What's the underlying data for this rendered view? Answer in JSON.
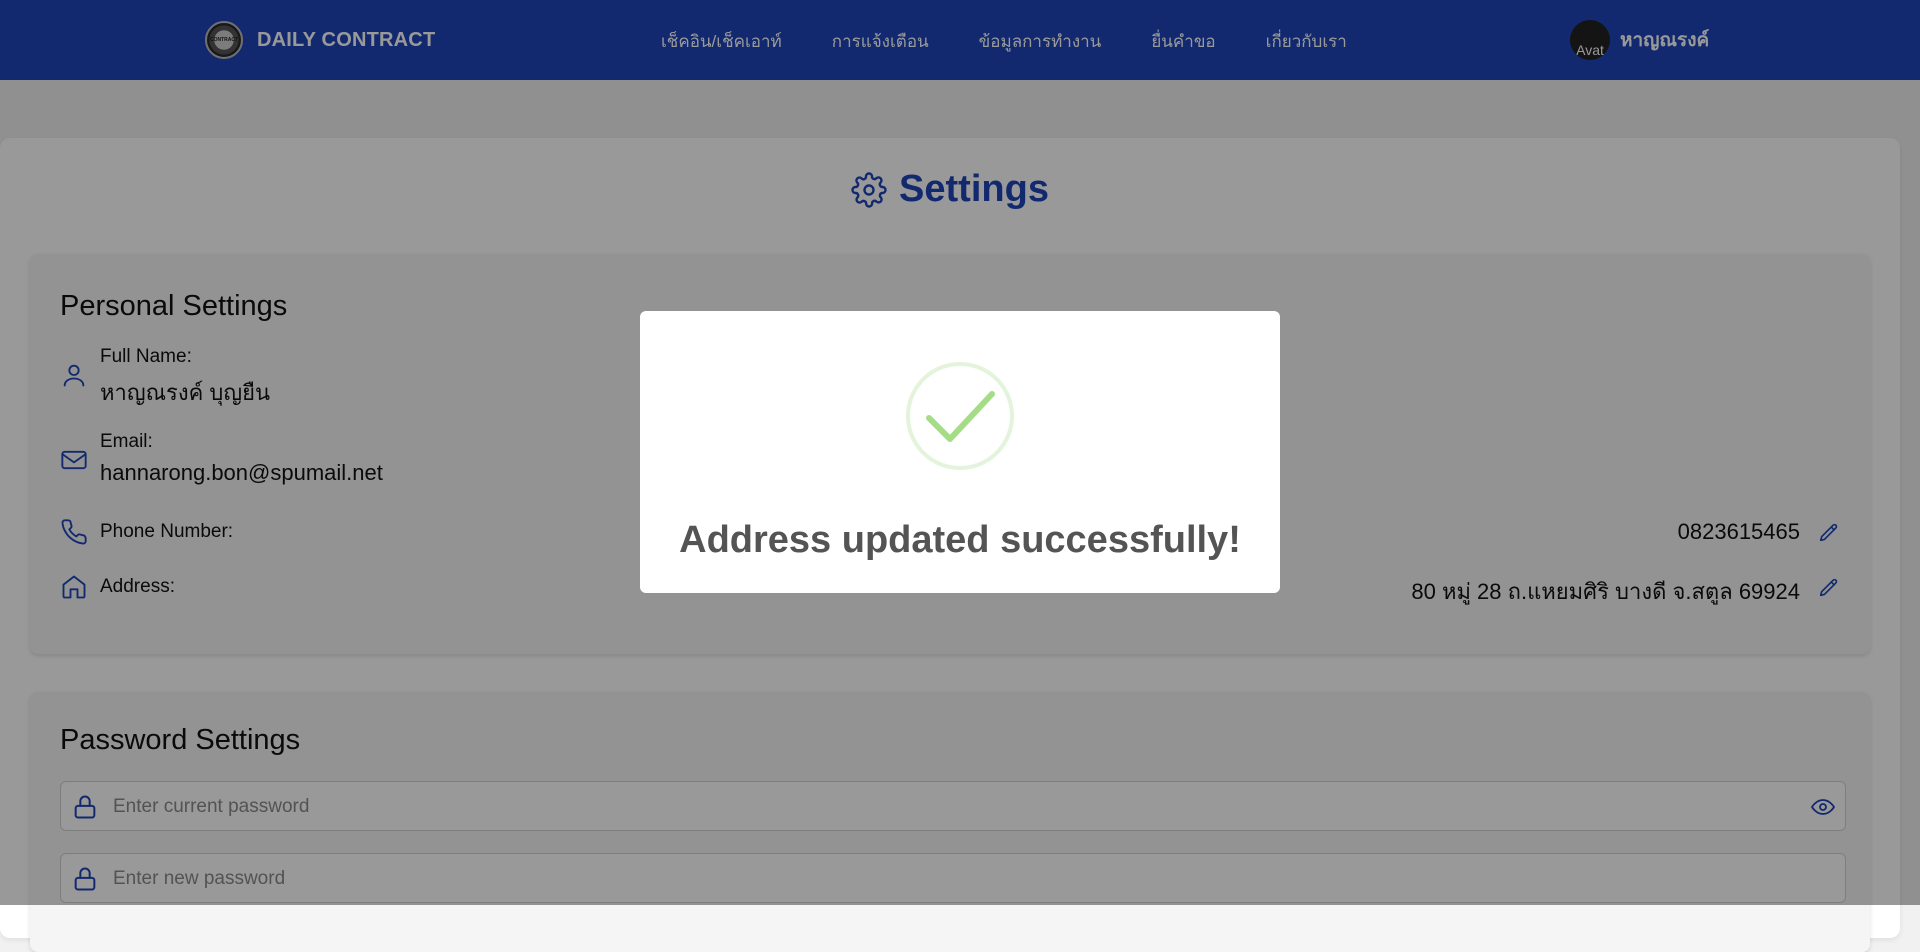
{
  "navbar": {
    "brand": "DAILY CONTRACT",
    "brand_logo_text": "CONTRACT",
    "links": [
      "เช็คอิน/เช็คเอาท์",
      "การแจ้งเตือน",
      "ข้อมูลการทำงาน",
      "ยื่นคำขอ",
      "เกี่ยวกับเรา"
    ],
    "avatar_alt": "Avat",
    "user_name": "หาญณรงค์"
  },
  "page": {
    "title": "Settings",
    "title_icon": "gear-icon"
  },
  "personal": {
    "title": "Personal Settings",
    "full_name_label": "Full Name:",
    "full_name": "หาญณรงค์ บุญยืน",
    "email_label": "Email:",
    "email": "hannarong.bon@spumail.net",
    "phone_label": "Phone Number:",
    "phone": "0823615465",
    "address_label": "Address:",
    "address": "80 หมู่ 28 ถ.แหยมศิริ บางดี จ.สตูล 69924"
  },
  "password": {
    "title": "Password Settings",
    "current_placeholder": "Enter current password",
    "new_placeholder": "Enter new password"
  },
  "modal": {
    "message": "Address updated successfully!",
    "icon": "success-check-icon"
  },
  "colors": {
    "primary": "#1e45b9",
    "success": "#a5dc86",
    "modal_text": "#545454"
  }
}
